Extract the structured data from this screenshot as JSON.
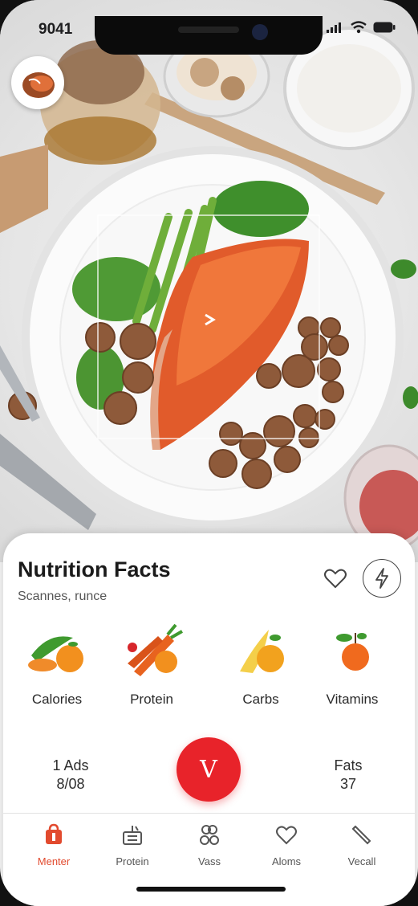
{
  "status_bar": {
    "time": "9041"
  },
  "sheet": {
    "title": "Nutrition Facts",
    "subtitle": "Scannes, runce"
  },
  "categories": [
    {
      "label": "Calories"
    },
    {
      "label": "Protein"
    },
    {
      "label": "Carbs"
    },
    {
      "label": "Vitamins"
    }
  ],
  "stats": {
    "left": {
      "line1": "1 Ads",
      "line2": "8/08"
    },
    "right": {
      "line1": "Fats",
      "line2": "37"
    }
  },
  "action_button": {
    "label": "V"
  },
  "tabs": [
    {
      "label": "Menter",
      "icon": "bag-icon",
      "active": true
    },
    {
      "label": "Protein",
      "icon": "scale-icon"
    },
    {
      "label": "Vass",
      "icon": "people-icon"
    },
    {
      "label": "Aloms",
      "icon": "heart-icon"
    },
    {
      "label": "Vecall",
      "icon": "pen-icon"
    }
  ],
  "colors": {
    "accent": "#e8232a",
    "active_tab": "#e24a2e"
  }
}
